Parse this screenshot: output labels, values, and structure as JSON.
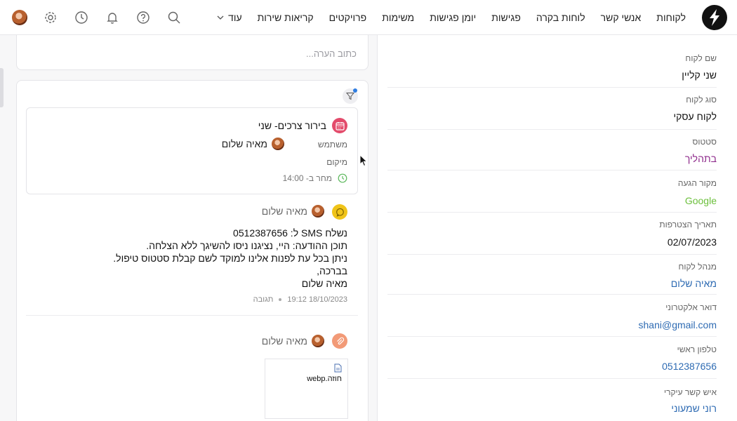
{
  "nav": {
    "items": [
      "לקוחות",
      "אנשי קשר",
      "לוחות בקרה",
      "פגישות",
      "יומן פגישות",
      "משימות",
      "פרויקטים",
      "קריאות שירות"
    ],
    "more_label": "עוד"
  },
  "top_icons": [
    "search-icon",
    "help-icon",
    "bell-icon",
    "clock-icon",
    "gear-icon",
    "user-avatar"
  ],
  "comment": {
    "placeholder": "כתוב הערה..."
  },
  "meeting": {
    "title": "בירור צרכים- שני",
    "user_label": "משתמש",
    "user_name": "מאיה שלום",
    "location_label": "מיקום",
    "time": "מחר ב- 14:00"
  },
  "sms": {
    "author": "מאיה שלום",
    "lines": [
      "נשלח SMS ל: 0512387656",
      "תוכן ההודעה: היי, נציגנו ניסו להשיגך ללא הצלחה.",
      "ניתן בכל עת לפנות אלינו למוקד לשם קבלת סטטוס טיפול.",
      "בברכה,",
      "מאיה שלום"
    ],
    "timestamp": "18/10/2023 19:12",
    "reply_label": "תגובה"
  },
  "attachment": {
    "author": "מאיה שלום",
    "file_name": "חוזה.webp"
  },
  "customer": {
    "fields": [
      {
        "label": "שם לקוח",
        "value": "שני קליין",
        "style": ""
      },
      {
        "label": "סוג לקוח",
        "value": "לקוח עסקי",
        "style": ""
      },
      {
        "label": "סטטוס",
        "value": "בתהליך",
        "style": "val-purple"
      },
      {
        "label": "מקור הגעה",
        "value": "Google",
        "style": "val-green"
      },
      {
        "label": "תאריך הצטרפות",
        "value": "02/07/2023",
        "style": ""
      },
      {
        "label": "מנהל לקוח",
        "value": "מאיה שלום",
        "style": "val-blue"
      },
      {
        "label": "דואר אלקטרוני",
        "value": "shani@gmail.com",
        "style": "val-blue"
      },
      {
        "label": "טלפון ראשי",
        "value": "0512387656",
        "style": "val-blue"
      },
      {
        "label": "איש קשר עיקרי",
        "value": "רוני שמעוני",
        "style": "val-blue"
      }
    ]
  },
  "colors": {
    "meeting_icon": "#e34b6b",
    "sms_icon": "#f0c419",
    "attachment_icon": "#f29a77",
    "status": "#8e2a8b",
    "source": "#6bbf3b",
    "link": "#2e6bb3"
  }
}
